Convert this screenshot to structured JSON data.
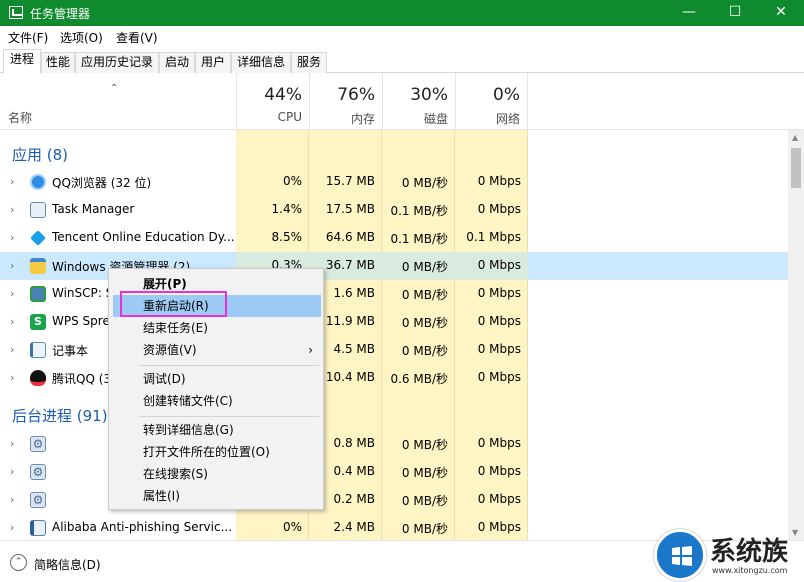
{
  "window": {
    "title": "任务管理器",
    "minimize_glyph": "—",
    "maximize_glyph": "☐",
    "close_glyph": "✕",
    "accent": "#108a2e"
  },
  "menu": [
    "文件(F)",
    "选项(O)",
    "查看(V)"
  ],
  "tabs": [
    "进程",
    "性能",
    "应用历史记录",
    "启动",
    "用户",
    "详细信息",
    "服务"
  ],
  "columns": {
    "name": "名称",
    "sort_glyph": "⌃",
    "cpu": {
      "pct": "44%",
      "label": "CPU"
    },
    "memory": {
      "pct": "76%",
      "label": "内存"
    },
    "disk": {
      "pct": "30%",
      "label": "磁盘"
    },
    "network": {
      "pct": "0%",
      "label": "网络"
    }
  },
  "groups": {
    "apps": "应用 (8)",
    "background": "后台进程 (91)"
  },
  "rows": [
    {
      "name": "QQ浏览器 (32 位)",
      "icon": "qq-browser-icon",
      "cpu": "0%",
      "mem": "15.7 MB",
      "disk": "0 MB/秒",
      "net": "0 Mbps"
    },
    {
      "name": "Task Manager",
      "icon": "task-manager-icon",
      "cpu": "1.4%",
      "mem": "17.5 MB",
      "disk": "0.1 MB/秒",
      "net": "0 Mbps"
    },
    {
      "name": "Tencent Online Education Dy...",
      "icon": "tencent-edu-icon",
      "cpu": "8.5%",
      "mem": "64.6 MB",
      "disk": "0.1 MB/秒",
      "net": "0.1 Mbps"
    },
    {
      "name": "Windows 资源管理器 (2)",
      "icon": "explorer-icon",
      "cpu": "0.3%",
      "mem": "36.7 MB",
      "disk": "0 MB/秒",
      "net": "0 Mbps"
    },
    {
      "name": "WinSCP: S",
      "icon": "winscp-icon",
      "cpu": "",
      "mem": "1.6 MB",
      "disk": "0 MB/秒",
      "net": "0 Mbps"
    },
    {
      "name": "WPS Spre",
      "icon": "wps-icon",
      "cpu": "",
      "mem": "11.9 MB",
      "disk": "0 MB/秒",
      "net": "0 Mbps"
    },
    {
      "name": "记事本",
      "icon": "notepad-icon",
      "cpu": "",
      "mem": "4.5 MB",
      "disk": "0 MB/秒",
      "net": "0 Mbps"
    },
    {
      "name": "腾讯QQ (3",
      "icon": "qq-icon",
      "cpu": "",
      "mem": "10.4 MB",
      "disk": "0.6 MB/秒",
      "net": "0 Mbps"
    }
  ],
  "bg_rows": [
    {
      "name": "",
      "icon": "gear-icon",
      "cpu": "",
      "mem": "0.8 MB",
      "disk": "0 MB/秒",
      "net": "0 Mbps"
    },
    {
      "name": "",
      "icon": "gear-icon",
      "cpu": "",
      "mem": "0.4 MB",
      "disk": "0 MB/秒",
      "net": "0 Mbps"
    },
    {
      "name": "",
      "icon": "gear-icon",
      "cpu": "",
      "mem": "0.2 MB",
      "disk": "0 MB/秒",
      "net": "0 Mbps"
    },
    {
      "name": "Alibaba Anti-phishing Servic...",
      "icon": "alibaba-icon",
      "cpu": "0%",
      "mem": "2.4 MB",
      "disk": "0 MB/秒",
      "net": "0 Mbps"
    }
  ],
  "context_menu": {
    "expand": "展开(P)",
    "restart": "重新启动(R)",
    "end_task": "结束任务(E)",
    "resource_values": "资源值(V)",
    "submenu_glyph": "›",
    "debug": "调试(D)",
    "create_dump": "创建转储文件(C)",
    "go_to_details": "转到详细信息(G)",
    "open_file_location": "打开文件所在的位置(O)",
    "search_online": "在线搜索(S)",
    "properties": "属性(I)",
    "highlight_color": "#e832d8"
  },
  "footer": {
    "fewer_details": "简略信息(D)",
    "collapse_glyph": "⌃"
  },
  "watermark": {
    "text": "系统族",
    "url": "www.xitongzu.com"
  }
}
